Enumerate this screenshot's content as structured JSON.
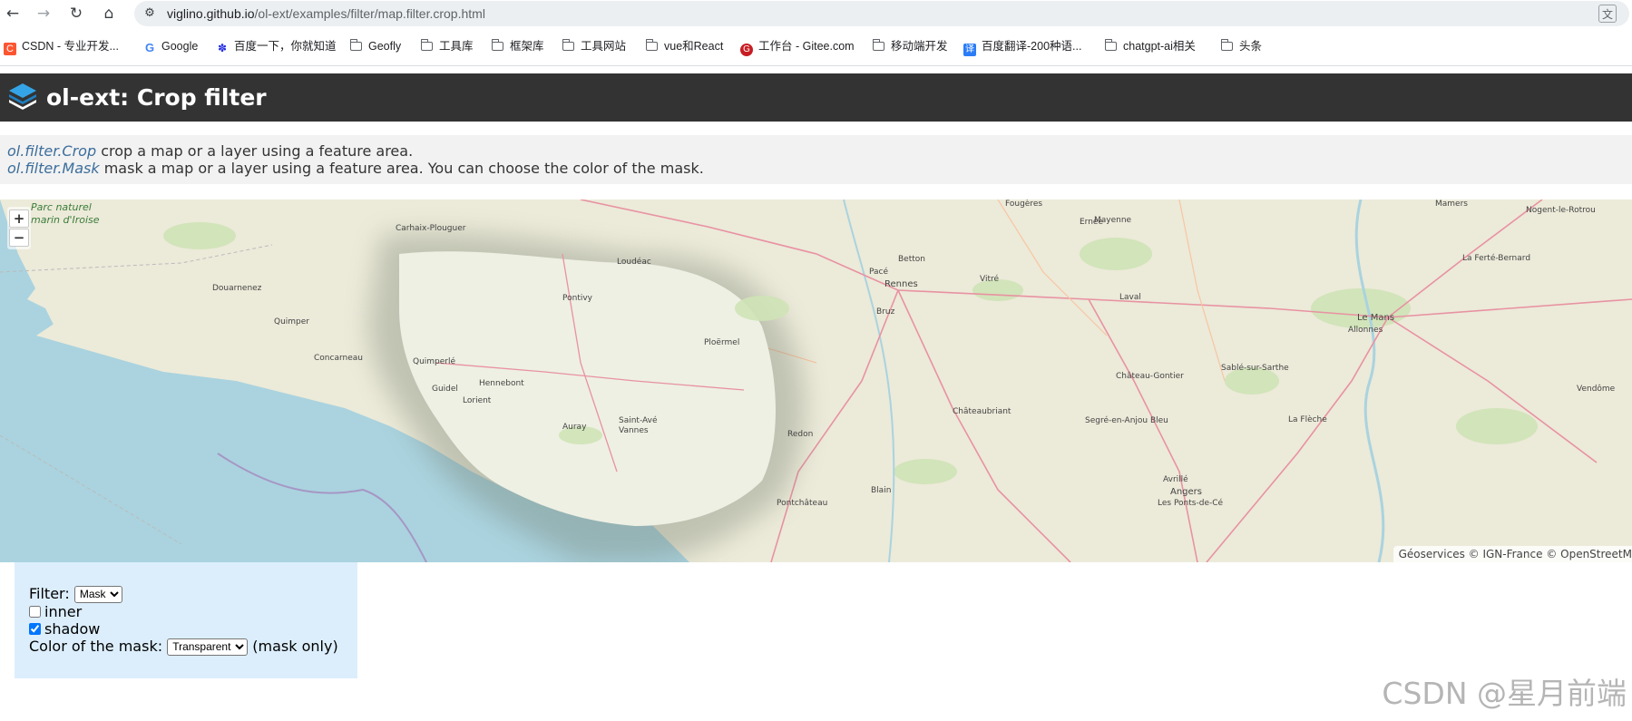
{
  "browser": {
    "url_domain": "viglino.github.io",
    "url_path": "/ol-ext/examples/filter/map.filter.crop.html",
    "bookmarks": [
      {
        "label": "CSDN - 专业开发...",
        "icon": "csdn-icon"
      },
      {
        "label": "Google",
        "icon": "google-icon"
      },
      {
        "label": "百度一下，你就知道",
        "icon": "baidu-icon"
      },
      {
        "label": "Geofly",
        "icon": "folder-icon"
      },
      {
        "label": "工具库",
        "icon": "folder-icon"
      },
      {
        "label": "框架库",
        "icon": "folder-icon"
      },
      {
        "label": "工具网站",
        "icon": "folder-icon"
      },
      {
        "label": "vue和React",
        "icon": "folder-icon"
      },
      {
        "label": "工作台 - Gitee.com",
        "icon": "gitee-icon"
      },
      {
        "label": "移动端开发",
        "icon": "folder-icon"
      },
      {
        "label": "百度翻译-200种语...",
        "icon": "baidu-translate-icon"
      },
      {
        "label": "chatgpt-ai相关",
        "icon": "folder-icon"
      },
      {
        "label": "头条",
        "icon": "folder-icon"
      }
    ]
  },
  "header": {
    "title": "ol-ext: Crop filter"
  },
  "info": {
    "crop_link": "ol.filter.Crop",
    "crop_text": " crop a map or a layer using a feature area.",
    "mask_link": "ol.filter.Mask",
    "mask_text": " mask a map or a layer using a feature area. You can choose the color of the mask."
  },
  "map": {
    "zoom_in": "+",
    "zoom_out": "−",
    "attribution": "Géoservices © IGN-France © OpenStreetM",
    "labels": {
      "parc_naturel": "Parc naturel",
      "marin_iroise": "marin d'Iroise",
      "carhaix": "Carhaix-Plouguer",
      "douarnenez": "Douarnenez",
      "quimper": "Quimper",
      "concarneau": "Concarneau",
      "quimperle": "Quimperlé",
      "guidel": "Guidel",
      "lorient": "Lorient",
      "hennebont": "Hennebont",
      "auray": "Auray",
      "saint_ave": "Saint-Avé",
      "vannes": "Vannes",
      "pontivy": "Pontivy",
      "loudeac": "Loudéac",
      "ploermel": "Ploërmel",
      "redon": "Redon",
      "pontchateau": "Pontchâteau",
      "blain": "Blain",
      "chateaubriant": "Châteaubriant",
      "segre": "Segré-en-Anjou Bleu",
      "angers": "Angers",
      "chateau_gontier": "Château-Gontier",
      "sable": "Sablé-sur-Sarthe",
      "la_fleche": "La Flèche",
      "le_mans": "Le Mans",
      "allonnes": "Allonnes",
      "laval": "Laval",
      "vitre": "Vitré",
      "rennes": "Rennes",
      "pace": "Pacé",
      "betton": "Betton",
      "bruz": "Bruz",
      "mayenne": "Mayenne",
      "ernee": "Ernée",
      "fougeres": "Fougères",
      "mamers": "Mamers",
      "nogent": "Nogent-le-Rotrou",
      "la_ferte": "La Ferté-Bernard",
      "vendome": "Vendôme",
      "avrille": "Avrillé",
      "ponts_de_ce": "Les Ponts-de-Cé"
    }
  },
  "options": {
    "filter_label": "Filter:",
    "filter_value": "Mask",
    "inner_label": "inner",
    "inner_checked": false,
    "shadow_label": "shadow",
    "shadow_checked": true,
    "color_label": "Color of the mask:",
    "color_value": "Transparent",
    "color_suffix": "(mask only)"
  },
  "watermark": "CSDN @星月前端"
}
